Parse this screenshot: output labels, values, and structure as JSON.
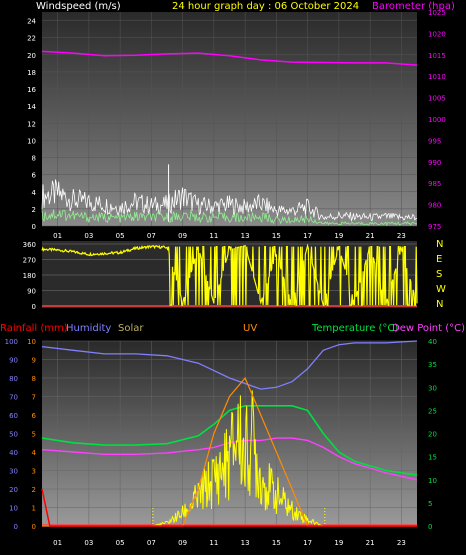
{
  "header": {
    "wind_label": "Windspeed (m/s)",
    "date_label": "24 hour graph day : 06 October 2024",
    "baro_label": "Barometer (hpa)"
  },
  "bottom_header": {
    "rain_label": "Rainfall (mm)",
    "humidity_label": "Humidity",
    "solar_label": "Solar",
    "uv_label": "UV",
    "temp_label": "Temperature (°C)",
    "dew_label": "Dew Point (°C)"
  },
  "colors": {
    "wind": "#ffffff",
    "wind_avg": "#90ee90",
    "baro": "#ff00ff",
    "direction": "#ffff00",
    "rain": "#ff0000",
    "humidity": "#8080ff",
    "solar": "#c0b060",
    "uv": "#ff8c00",
    "temperature": "#00e040",
    "dewpoint": "#ff40ff",
    "solar_line": "#ffff00"
  },
  "chart_data": [
    {
      "type": "line",
      "name": "wind_baro",
      "x_ticks": [
        "01",
        "03",
        "05",
        "07",
        "09",
        "11",
        "13",
        "15",
        "17",
        "19",
        "21",
        "23"
      ],
      "y_left_ticks": [
        "0",
        "2",
        "4",
        "6",
        "8",
        "10",
        "12",
        "14",
        "16",
        "18",
        "20",
        "22",
        "24"
      ],
      "y_left_range": [
        0,
        25
      ],
      "y_right_ticks": [
        "975",
        "980",
        "985",
        "990",
        "995",
        "1000",
        "1005",
        "1010",
        "1015",
        "1020",
        "1025"
      ],
      "y_right_range": [
        975,
        1025
      ],
      "series": [
        {
          "name": "gust",
          "x": [
            0,
            1,
            2,
            3,
            4,
            5,
            6,
            7,
            8,
            9,
            10,
            11,
            12,
            13,
            14,
            15,
            16,
            17,
            18,
            19,
            20,
            21,
            22,
            23,
            24
          ],
          "y": [
            3.5,
            3.8,
            3,
            2.8,
            2.5,
            2.2,
            2.8,
            2.4,
            2.5,
            3.5,
            2.4,
            2.3,
            2.5,
            2.2,
            2.6,
            1.8,
            1.8,
            2.2,
            1,
            1.2,
            1.1,
            1,
            1.1,
            1,
            1
          ]
        },
        {
          "name": "avg",
          "x": [
            0,
            1,
            2,
            3,
            4,
            5,
            6,
            7,
            8,
            9,
            10,
            11,
            12,
            13,
            14,
            15,
            16,
            17,
            18,
            19,
            20,
            21,
            22,
            23,
            24
          ],
          "y": [
            1.2,
            1.5,
            1.2,
            1,
            1,
            0.9,
            1.1,
            1,
            1,
            1.2,
            1,
            1,
            1,
            0.9,
            1.1,
            0.7,
            0.7,
            0.9,
            0.3,
            0.3,
            0.3,
            0.3,
            0.3,
            0.3,
            0.3
          ]
        },
        {
          "name": "baro",
          "x": [
            0,
            2,
            4,
            6,
            8,
            10,
            12,
            14,
            16,
            18,
            20,
            22,
            24
          ],
          "y": [
            1015.8,
            1015.4,
            1014.8,
            1014.9,
            1015.2,
            1015.4,
            1014.8,
            1013.8,
            1013.3,
            1013.2,
            1013.1,
            1013.1,
            1012.6
          ]
        }
      ]
    },
    {
      "type": "line",
      "name": "wind_direction",
      "x_ticks": [],
      "y_left_ticks": [
        "0",
        "90",
        "180",
        "270",
        "360"
      ],
      "y_left_range": [
        0,
        360
      ],
      "y_right_ticks": [
        "N",
        "W",
        "S",
        "E",
        "N"
      ],
      "series": [
        {
          "name": "direction",
          "x": [
            0,
            1,
            2,
            3,
            4,
            5,
            6,
            7,
            8,
            9,
            10,
            11,
            12,
            13,
            14,
            15,
            16,
            17,
            18,
            19,
            20,
            21,
            22,
            23,
            24
          ],
          "y": [
            330,
            325,
            315,
            300,
            305,
            310,
            335,
            345,
            340,
            20,
            340,
            15,
            330,
            350,
            20,
            300,
            10,
            350,
            5,
            340,
            20,
            350,
            10,
            330,
            15
          ]
        }
      ]
    },
    {
      "type": "line",
      "name": "rain_humidity_temp",
      "x_ticks": [
        "01",
        "03",
        "05",
        "07",
        "09",
        "11",
        "13",
        "15",
        "17",
        "19",
        "21",
        "23"
      ],
      "y_left_ticks": [
        "0",
        "10",
        "20",
        "30",
        "40",
        "50",
        "60",
        "70",
        "80",
        "90",
        "100"
      ],
      "y_left_range": [
        0,
        100
      ],
      "y_mid_ticks": [
        "0",
        "1",
        "2",
        "3",
        "4",
        "5",
        "6",
        "7",
        "8",
        "9",
        "10"
      ],
      "y_right_ticks": [
        "0",
        "5",
        "10",
        "15",
        "20",
        "25",
        "30",
        "35",
        "40"
      ],
      "y_right_range": [
        0,
        40
      ],
      "series": [
        {
          "name": "humidity",
          "x": [
            0,
            2,
            4,
            6,
            8,
            10,
            11,
            12,
            13,
            14,
            15,
            16,
            17,
            18,
            19,
            20,
            22,
            24
          ],
          "y": [
            97,
            95,
            93,
            93,
            92,
            88,
            84,
            80,
            77,
            74,
            75,
            78,
            85,
            95,
            98,
            99,
            99,
            100
          ]
        },
        {
          "name": "temperature",
          "x": [
            0,
            2,
            4,
            6,
            8,
            10,
            11,
            12,
            13,
            14,
            15,
            16,
            17,
            18,
            19,
            20,
            22,
            24
          ],
          "y": [
            19,
            18,
            17.5,
            17.5,
            17.8,
            19.5,
            22,
            25,
            26,
            26,
            26,
            26,
            25,
            20,
            16,
            14,
            12,
            11
          ]
        },
        {
          "name": "dewpoint",
          "x": [
            0,
            2,
            4,
            6,
            8,
            10,
            11,
            12,
            13,
            14,
            15,
            16,
            17,
            18,
            19,
            20,
            22,
            24
          ],
          "y": [
            16.5,
            16,
            15.5,
            15.5,
            15.8,
            16.5,
            17,
            18,
            18.5,
            18.5,
            19,
            19,
            18.5,
            17,
            15,
            13.5,
            11.5,
            10
          ]
        },
        {
          "name": "solar",
          "x": [
            0,
            7,
            8,
            9,
            10,
            11,
            12,
            12.5,
            13,
            13.5,
            14,
            15,
            16,
            17,
            18,
            24
          ],
          "y": [
            0,
            0,
            2,
            8,
            18,
            30,
            42,
            60,
            45,
            55,
            30,
            20,
            10,
            4,
            0,
            0
          ]
        },
        {
          "name": "uv",
          "x": [
            0,
            9,
            10,
            11,
            12,
            13,
            14,
            15,
            16,
            17,
            24
          ],
          "y": [
            0,
            0,
            2,
            5,
            7,
            8,
            6,
            4,
            2,
            0,
            0
          ]
        },
        {
          "name": "rain",
          "x": [
            0,
            0.5,
            24
          ],
          "y": [
            2,
            0,
            0
          ]
        }
      ]
    }
  ]
}
